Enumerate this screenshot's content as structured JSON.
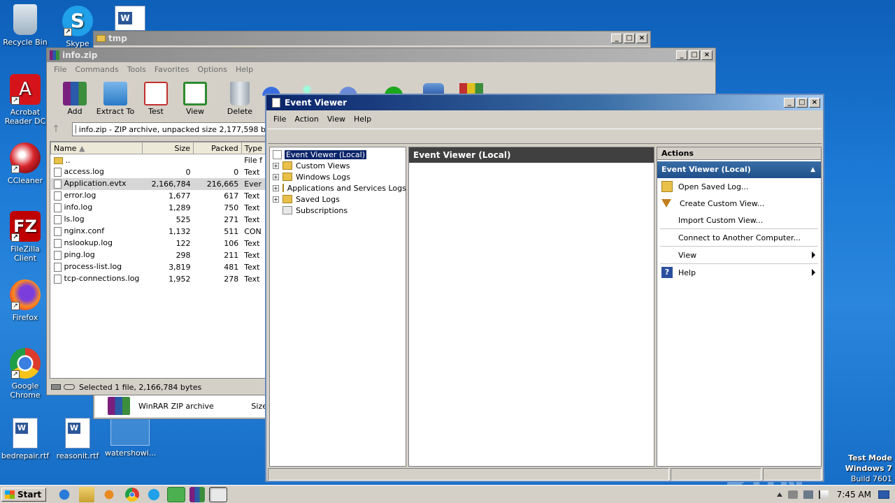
{
  "desktop": {
    "icons": [
      {
        "label": "Recycle Bin",
        "icon": "recycle-bin-icon"
      },
      {
        "label": "Skype",
        "icon": "skype-icon"
      },
      {
        "label": "Acrobat Reader DC",
        "icon": "acrobat-icon"
      },
      {
        "label": "CCleaner",
        "icon": "ccleaner-icon"
      },
      {
        "label": "FileZilla Client",
        "icon": "filezilla-icon"
      },
      {
        "label": "Firefox",
        "icon": "firefox-icon"
      },
      {
        "label": "Google Chrome",
        "icon": "chrome-icon"
      },
      {
        "label": "bedrepair.rtf",
        "icon": "word-doc-icon"
      },
      {
        "label": "reasonit.rtf",
        "icon": "word-doc-icon"
      },
      {
        "label": "watershowi...",
        "icon": "blank-doc-icon"
      }
    ],
    "watermark": "ANY RUN",
    "os_info": {
      "line1": "Test Mode",
      "line2": "Windows 7",
      "line3": "Build 7601"
    }
  },
  "tmp_window": {
    "title": "tmp",
    "file_type_row": {
      "name": "WinRAR ZIP archive",
      "col": "Size"
    }
  },
  "winrar": {
    "title": "info.zip",
    "menu": [
      "File",
      "Commands",
      "Tools",
      "Favorites",
      "Options",
      "Help"
    ],
    "toolbar": [
      "Add",
      "Extract To",
      "Test",
      "View",
      "Delete"
    ],
    "path": "info.zip - ZIP archive, unpacked size 2,177,598 b",
    "columns": [
      "Name",
      "Size",
      "Packed",
      "Type"
    ],
    "files": [
      {
        "name": "..",
        "size": "",
        "packed": "",
        "type": "File f",
        "folder": true
      },
      {
        "name": "access.log",
        "size": "0",
        "packed": "0",
        "type": "Text"
      },
      {
        "name": "Application.evtx",
        "size": "2,166,784",
        "packed": "216,665",
        "type": "Ever",
        "selected": true
      },
      {
        "name": "error.log",
        "size": "1,677",
        "packed": "617",
        "type": "Text"
      },
      {
        "name": "info.log",
        "size": "1,289",
        "packed": "750",
        "type": "Text"
      },
      {
        "name": "ls.log",
        "size": "525",
        "packed": "271",
        "type": "Text"
      },
      {
        "name": "nginx.conf",
        "size": "1,132",
        "packed": "511",
        "type": "CON"
      },
      {
        "name": "nslookup.log",
        "size": "122",
        "packed": "106",
        "type": "Text"
      },
      {
        "name": "ping.log",
        "size": "298",
        "packed": "211",
        "type": "Text"
      },
      {
        "name": "process-list.log",
        "size": "3,819",
        "packed": "481",
        "type": "Text"
      },
      {
        "name": "tcp-connections.log",
        "size": "1,952",
        "packed": "278",
        "type": "Text"
      }
    ],
    "status": "Selected 1 file, 2,166,784 bytes"
  },
  "event_viewer": {
    "title": "Event Viewer",
    "menu": [
      "File",
      "Action",
      "View",
      "Help"
    ],
    "tree": [
      {
        "label": "Event Viewer (Local)",
        "root": true
      },
      {
        "label": "Custom Views"
      },
      {
        "label": "Windows Logs"
      },
      {
        "label": "Applications and Services Logs"
      },
      {
        "label": "Saved Logs"
      },
      {
        "label": "Subscriptions",
        "leaf": true
      }
    ],
    "center_header": "Event Viewer (Local)",
    "actions_header": "Actions",
    "actions_subheader": "Event Viewer (Local)",
    "actions": [
      {
        "label": "Open Saved Log...",
        "icon": "folder-open-icon"
      },
      {
        "label": "Create Custom View...",
        "icon": "filter-icon"
      },
      {
        "label": "Import Custom View...",
        "icon": ""
      },
      {
        "label": "Connect to Another Computer...",
        "icon": ""
      },
      {
        "label": "View",
        "icon": "",
        "submenu": true
      },
      {
        "label": "Help",
        "icon": "help-icon",
        "submenu": true
      }
    ]
  },
  "taskbar": {
    "start": "Start",
    "clock": "7:45 AM"
  },
  "colors": {
    "title_active": "#0a246a",
    "desktop": "#1c7ad6",
    "action_header": "#3a6ea5"
  }
}
